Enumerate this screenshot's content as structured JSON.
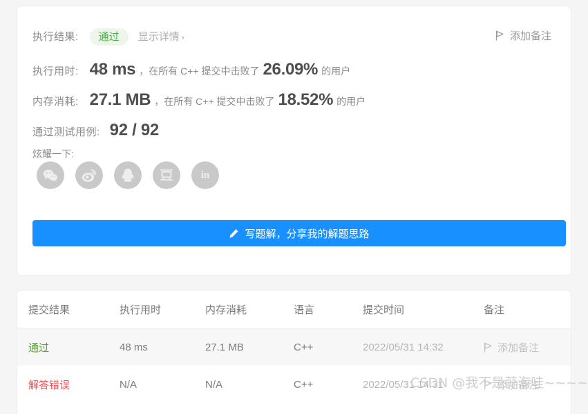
{
  "result_card": {
    "result_row": {
      "label": "执行结果:",
      "status": "通过",
      "detail_link": "显示详情",
      "chevron": "›"
    },
    "note_button": {
      "label": "添加备注",
      "icon": "flag-icon"
    },
    "runtime_row": {
      "label": "执行用时:",
      "value": "48 ms",
      "mid_text": "，在所有 C++ 提交中击败了",
      "percent": "26.09",
      "percent_symbol": "%",
      "suffix": "的用户"
    },
    "memory_row": {
      "label": "内存消耗:",
      "value": "27.1 MB",
      "mid_text": "，在所有 C++ 提交中击败了",
      "percent": "18.52",
      "percent_symbol": "%",
      "suffix": "的用户"
    },
    "testcase_row": {
      "label": "通过测试用例:",
      "value": "92 / 92"
    },
    "share": {
      "label": "炫耀一下:",
      "items": [
        {
          "name": "wechat-icon",
          "title": "微信"
        },
        {
          "name": "weibo-icon",
          "title": "微博"
        },
        {
          "name": "qq-icon",
          "title": "QQ"
        },
        {
          "name": "douban-icon",
          "title": "豆瓣",
          "glyph": "豆"
        },
        {
          "name": "linkedin-icon",
          "title": "LinkedIn",
          "glyph": "in"
        }
      ]
    },
    "solution_button": {
      "label": "写题解，分享我的解题思路",
      "icon": "pencil-icon"
    }
  },
  "submissions_table": {
    "headers": [
      "提交结果",
      "执行用时",
      "内存消耗",
      "语言",
      "提交时间",
      "备注"
    ],
    "rows": [
      {
        "status": "通过",
        "status_type": "pass",
        "runtime": "48 ms",
        "memory": "27.1 MB",
        "language": "C++",
        "time": "2022/05/31 14:32",
        "note": "添加备注"
      },
      {
        "status": "解答错误",
        "status_type": "wrong",
        "runtime": "N/A",
        "memory": "N/A",
        "language": "C++",
        "time": "2022/05/31 14:31",
        "note": "添加备注"
      }
    ]
  },
  "watermark": "CSDN @我不是蒜海哇~~~~",
  "colors": {
    "accent_blue": "#1890ff",
    "pass_green": "#55a532",
    "badge_green_bg": "#eef6e9",
    "error_red": "#ff4d4f",
    "page_bg": "#f5f5f5",
    "card_bg": "#ffffff",
    "row_alt_bg": "#f7f7f7"
  }
}
